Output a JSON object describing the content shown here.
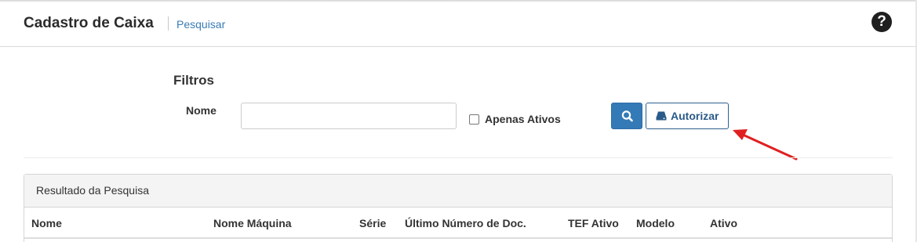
{
  "header": {
    "title": "Cadastro de Caixa",
    "breadcrumb_link": "Pesquisar",
    "help_icon": "question-circle-icon",
    "help_glyph": "?"
  },
  "filters": {
    "title": "Filtros",
    "nome_label": "Nome",
    "nome_value": "",
    "only_active_label": "Apenas Ativos",
    "only_active_checked": false,
    "search_button_icon": "search-icon",
    "authorize_button_icon": "hdd-drive-icon",
    "authorize_label": "Autorizar"
  },
  "results": {
    "heading": "Resultado da Pesquisa",
    "columns": [
      "Nome",
      "Nome Máquina",
      "Série",
      "Último Número de Doc.",
      "TEF Ativo",
      "Modelo",
      "Ativo"
    ],
    "rows": []
  },
  "annotation": {
    "arrow_color": "#e02020"
  },
  "colors": {
    "primary": "#337ab7",
    "link": "#3a7bb5"
  }
}
